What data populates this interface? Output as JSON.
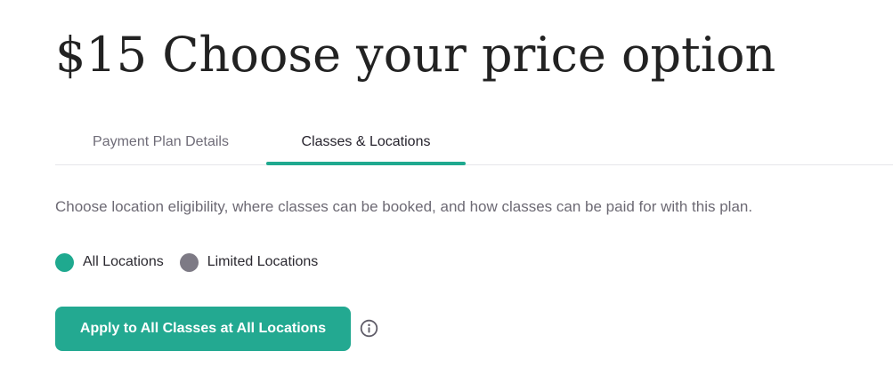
{
  "header": {
    "title": "$15 Choose your price option"
  },
  "tabs": [
    {
      "label": "Payment Plan Details",
      "active": false
    },
    {
      "label": "Classes & Locations",
      "active": true
    }
  ],
  "main": {
    "description": "Choose location eligibility, where classes can be booked, and how classes can be paid for with this plan.",
    "location_options": [
      {
        "label": "All Locations",
        "selected": true
      },
      {
        "label": "Limited Locations",
        "selected": false
      }
    ],
    "apply_button_label": "Apply to All Classes at All Locations",
    "info_icon": "info-icon"
  },
  "colors": {
    "accent": "#1fa98f",
    "inactive_radio": "#7d7a85",
    "muted_text": "#6d6a74"
  }
}
